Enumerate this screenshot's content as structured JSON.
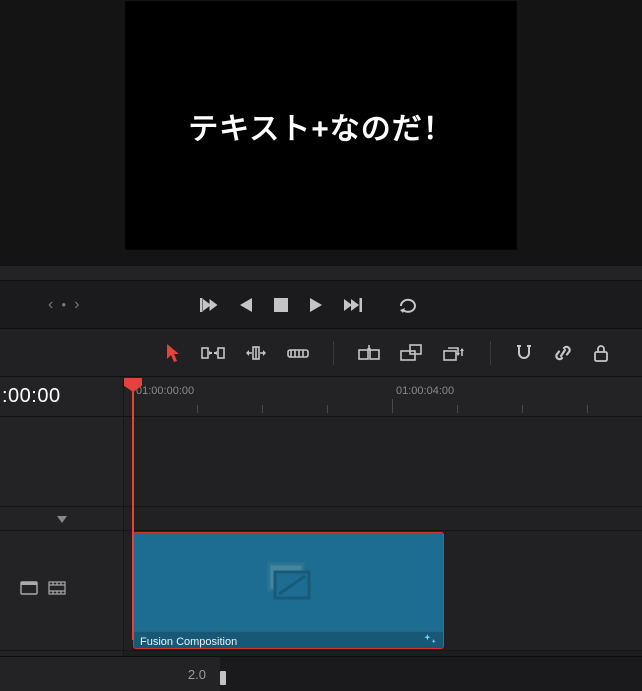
{
  "viewer": {
    "overlay_text": "テキスト+なのだ！"
  },
  "timecode": {
    "main": ":00:00",
    "ruler_1": "01:00:00:00",
    "ruler_2": "01:00:04:00"
  },
  "clip": {
    "title": "Fusion Composition"
  },
  "status": {
    "value": "2.0"
  },
  "icons": {
    "prev_page": "‹",
    "next_page": "›",
    "dot": "●"
  }
}
